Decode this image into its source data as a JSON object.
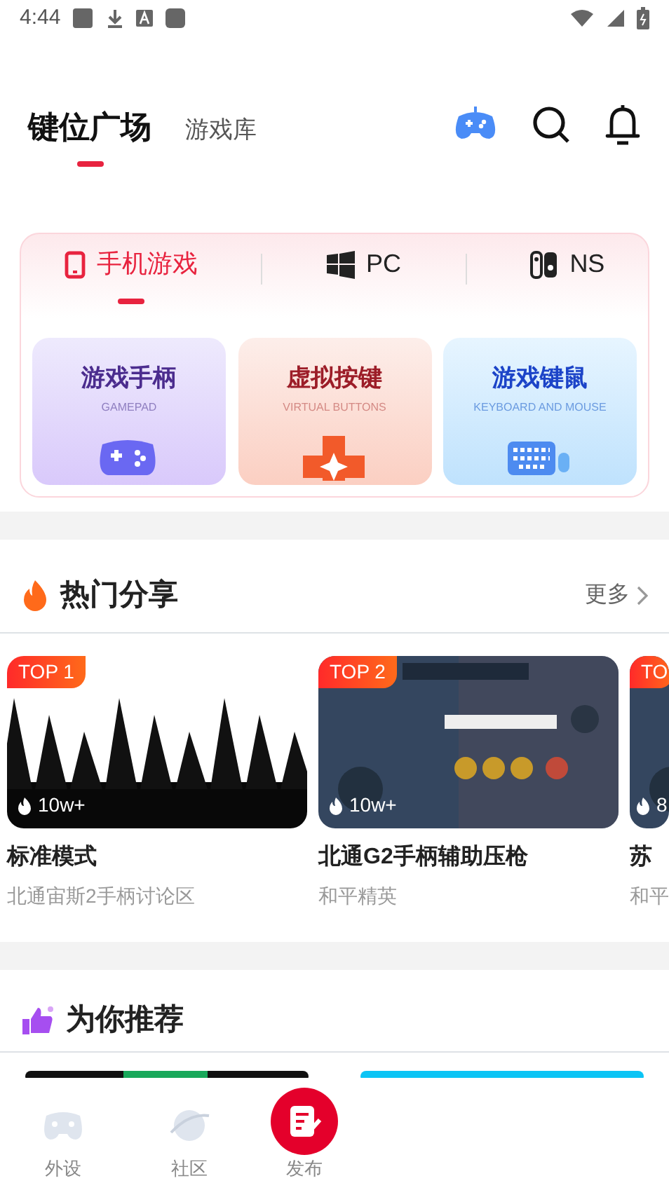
{
  "status_bar": {
    "time": "4:44"
  },
  "header_tabs": [
    {
      "label": "键位广场",
      "selected": true
    },
    {
      "label": "游戏库",
      "selected": false
    }
  ],
  "platform_tabs": [
    {
      "label": "手机游戏",
      "selected": true,
      "kind": "phone"
    },
    {
      "label": "PC",
      "selected": false,
      "kind": "windows"
    },
    {
      "label": "NS",
      "selected": false,
      "kind": "switch"
    }
  ],
  "modes": [
    {
      "title": "游戏手柄",
      "subtitle": "GAMEPAD",
      "kind": "gamepad"
    },
    {
      "title": "虚拟按键",
      "subtitle": "VIRTUAL BUTTONS",
      "kind": "dpad"
    },
    {
      "title": "游戏键鼠",
      "subtitle": "KEYBOARD AND MOUSE",
      "kind": "keyboard"
    }
  ],
  "hot_share": {
    "title": "热门分享",
    "more": "更多",
    "items": [
      {
        "rank": "TOP 1",
        "views": "10w+",
        "title": "标准模式",
        "subtitle": "北通宙斯2手柄讨论区",
        "kind": "forest"
      },
      {
        "rank": "TOP 2",
        "views": "10w+",
        "title": "北通G2手柄辅助压枪",
        "subtitle": "和平精英",
        "kind": "hud"
      },
      {
        "rank": "TO",
        "views": "8",
        "title": "苏",
        "subtitle": "和平",
        "kind": "hud"
      }
    ]
  },
  "recommend": {
    "title": "为你推荐"
  },
  "bottom_nav": [
    {
      "label": "外设",
      "kind": "gamepad"
    },
    {
      "label": "社区",
      "kind": "planet"
    },
    {
      "label": "发布",
      "kind": "publish"
    }
  ]
}
